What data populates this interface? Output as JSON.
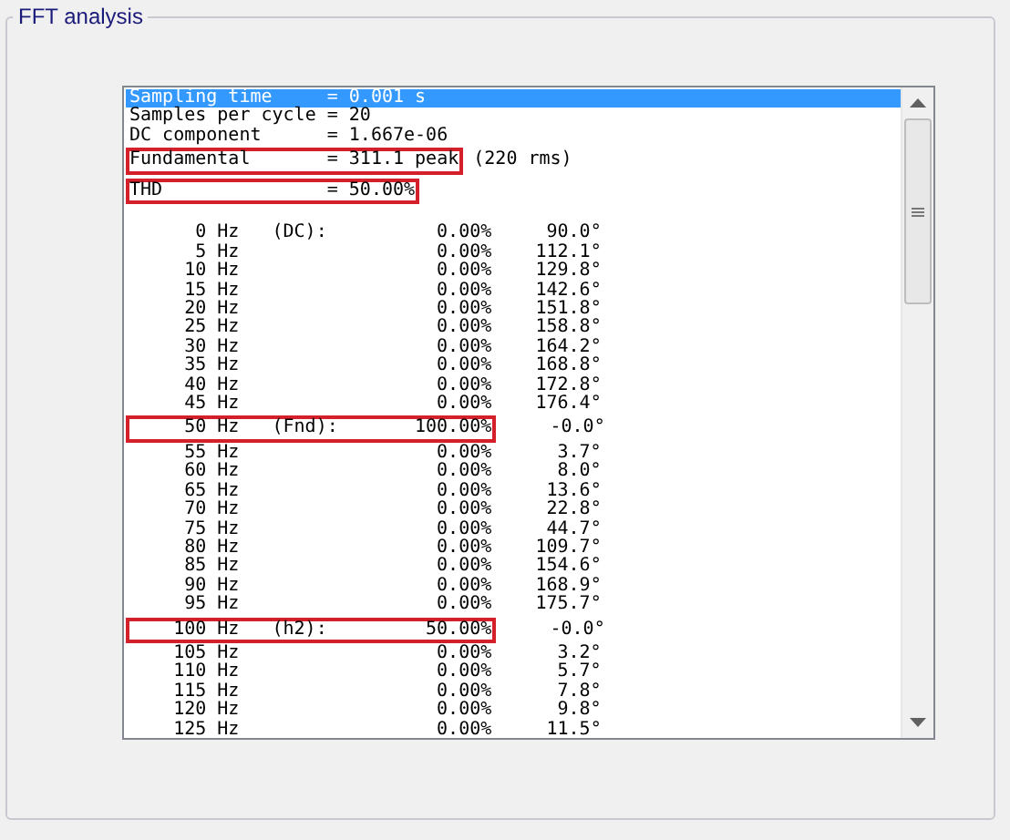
{
  "group": {
    "title": "FFT analysis"
  },
  "summary": [
    {
      "label": "Sampling time",
      "value": "= 0.001 s",
      "selected": true,
      "highlighted": false
    },
    {
      "label": "Samples per cycle",
      "value": "= 20",
      "selected": false,
      "highlighted": false
    },
    {
      "label": "DC component",
      "value": "= 1.667e-06",
      "selected": false,
      "highlighted": false
    },
    {
      "label": "Fundamental",
      "value": "= 311.1 peak",
      "extra": "(220 rms)",
      "selected": false,
      "highlighted": true
    },
    {
      "label": "THD",
      "value": "= 50.00%",
      "selected": false,
      "highlighted": true
    }
  ],
  "harmonics": [
    {
      "freq": "0 Hz",
      "tag": "(DC):",
      "magnitude": "0.00%",
      "phase": "90.0°",
      "highlighted": false
    },
    {
      "freq": "5 Hz",
      "magnitude": "0.00%",
      "phase": "112.1°",
      "highlighted": false
    },
    {
      "freq": "10 Hz",
      "magnitude": "0.00%",
      "phase": "129.8°",
      "highlighted": false
    },
    {
      "freq": "15 Hz",
      "magnitude": "0.00%",
      "phase": "142.6°",
      "highlighted": false
    },
    {
      "freq": "20 Hz",
      "magnitude": "0.00%",
      "phase": "151.8°",
      "highlighted": false
    },
    {
      "freq": "25 Hz",
      "magnitude": "0.00%",
      "phase": "158.8°",
      "highlighted": false
    },
    {
      "freq": "30 Hz",
      "magnitude": "0.00%",
      "phase": "164.2°",
      "highlighted": false
    },
    {
      "freq": "35 Hz",
      "magnitude": "0.00%",
      "phase": "168.8°",
      "highlighted": false
    },
    {
      "freq": "40 Hz",
      "magnitude": "0.00%",
      "phase": "172.8°",
      "highlighted": false
    },
    {
      "freq": "45 Hz",
      "magnitude": "0.00%",
      "phase": "176.4°",
      "highlighted": false
    },
    {
      "freq": "50 Hz",
      "tag": "(Fnd):",
      "magnitude": "100.00%",
      "phase": "-0.0°",
      "highlighted": true
    },
    {
      "freq": "55 Hz",
      "magnitude": "0.00%",
      "phase": "3.7°",
      "highlighted": false
    },
    {
      "freq": "60 Hz",
      "magnitude": "0.00%",
      "phase": "8.0°",
      "highlighted": false
    },
    {
      "freq": "65 Hz",
      "magnitude": "0.00%",
      "phase": "13.6°",
      "highlighted": false
    },
    {
      "freq": "70 Hz",
      "magnitude": "0.00%",
      "phase": "22.8°",
      "highlighted": false
    },
    {
      "freq": "75 Hz",
      "magnitude": "0.00%",
      "phase": "44.7°",
      "highlighted": false
    },
    {
      "freq": "80 Hz",
      "magnitude": "0.00%",
      "phase": "109.7°",
      "highlighted": false
    },
    {
      "freq": "85 Hz",
      "magnitude": "0.00%",
      "phase": "154.6°",
      "highlighted": false
    },
    {
      "freq": "90 Hz",
      "magnitude": "0.00%",
      "phase": "168.9°",
      "highlighted": false
    },
    {
      "freq": "95 Hz",
      "magnitude": "0.00%",
      "phase": "175.7°",
      "highlighted": false
    },
    {
      "freq": "100 Hz",
      "tag": "(h2):",
      "magnitude": "50.00%",
      "phase": "-0.0°",
      "highlighted": true
    },
    {
      "freq": "105 Hz",
      "magnitude": "0.00%",
      "phase": "3.2°",
      "highlighted": false
    },
    {
      "freq": "110 Hz",
      "magnitude": "0.00%",
      "phase": "5.7°",
      "highlighted": false
    },
    {
      "freq": "115 Hz",
      "magnitude": "0.00%",
      "phase": "7.8°",
      "highlighted": false
    },
    {
      "freq": "120 Hz",
      "magnitude": "0.00%",
      "phase": "9.8°",
      "highlighted": false
    },
    {
      "freq": "125 Hz",
      "magnitude": "0.00%",
      "phase": "11.5°",
      "highlighted": false
    }
  ]
}
